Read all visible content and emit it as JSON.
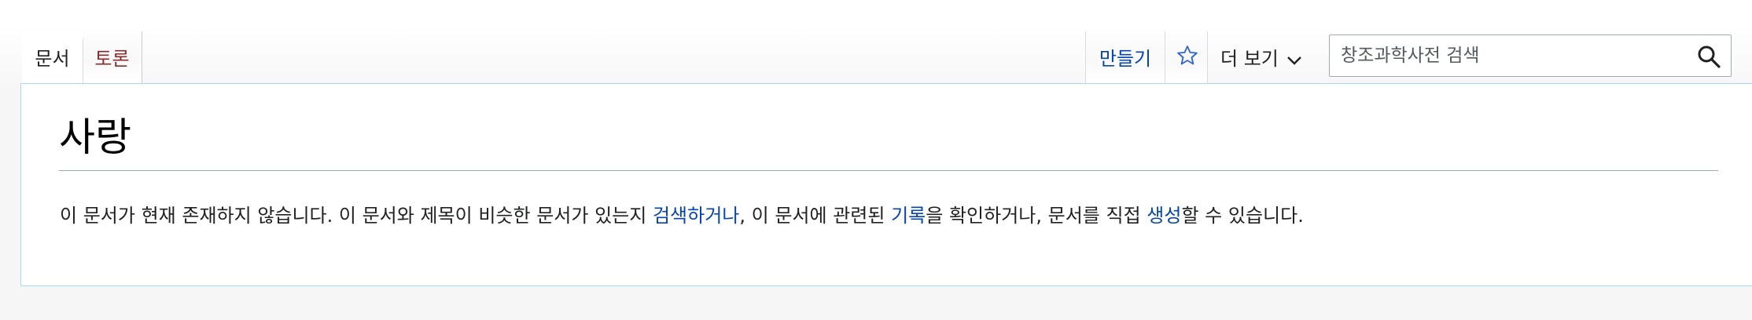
{
  "tabs": {
    "page": "문서",
    "talk": "토론",
    "create": "만들기",
    "more": "더 보기"
  },
  "search": {
    "placeholder": "창조과학사전 검색"
  },
  "icons": {
    "star": "star-outline-icon",
    "chevron": "chevron-down-icon",
    "search": "search-icon"
  },
  "colors": {
    "link": "#0645ad",
    "talk_link": "#8b2a2a",
    "border_accent": "#a7d7f9"
  },
  "article": {
    "title": "사랑",
    "text_1": "이 문서가 현재 존재하지 않습니다. 이 문서와 제목이 비슷한 문서가 있는지 ",
    "link_search": "검색하거나",
    "text_2": ", 이 문서에 관련된 ",
    "link_log": "기록",
    "text_3": "을 확인하거나, 문서를 직접 ",
    "link_create": "생성",
    "text_4": "할 수 있습니다."
  }
}
